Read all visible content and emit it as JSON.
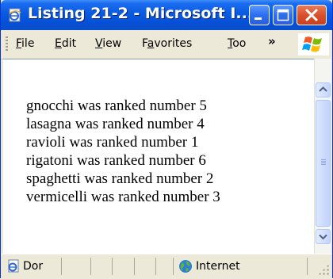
{
  "window": {
    "title": "Listing 21-2 - Microsoft I..."
  },
  "menubar": {
    "items": [
      {
        "label": "File",
        "key": "F",
        "rest": "ile"
      },
      {
        "label": "Edit",
        "key": "E",
        "rest": "dit"
      },
      {
        "label": "View",
        "key": "V",
        "rest": "iew"
      },
      {
        "label": "Favorites",
        "pre": "F",
        "key": "a",
        "rest": "vorites"
      },
      {
        "label": "Too",
        "key": "T",
        "rest": "oo"
      }
    ],
    "overflow": "»"
  },
  "content": {
    "lines": [
      "gnocchi was ranked number 5",
      "lasagna was ranked number 4",
      "ravioli was ranked number 1",
      "rigatoni was ranked number 6",
      "spaghetti was ranked number 2",
      "vermicelli was ranked number 3"
    ]
  },
  "statusbar": {
    "status": "Dor",
    "zone": "Internet"
  },
  "icons": {
    "title": "ie-page-icon",
    "status": "ie-page-icon",
    "zone": "globe-icon",
    "logo": "windows-logo-icon"
  },
  "colors": {
    "titlebar": "#0a5ae0",
    "close": "#d9512c",
    "chrome": "#ece9d8"
  }
}
